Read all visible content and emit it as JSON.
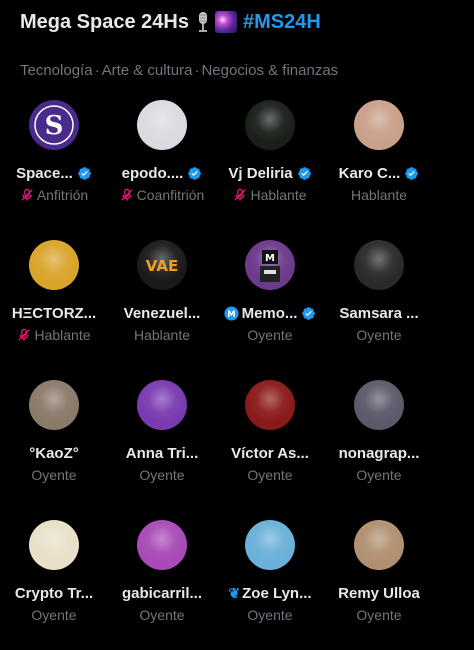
{
  "header": {
    "title": "Mega Space 24Hs",
    "emoji_1": "microphone-emoji",
    "emoji_2": "galaxy-emoji",
    "hashtag": "#MS24H"
  },
  "topics": [
    "Tecnología",
    "Arte & cultura",
    "Negocios &  finanzas"
  ],
  "topic_separator": "·",
  "colors": {
    "background": "#000000",
    "text": "#e7e9ea",
    "muted": "#71767b",
    "accent": "#1d9bf0",
    "mic_off": "#f91880"
  },
  "participants": [
    {
      "name": "Space...",
      "role": "Anfitrión",
      "verified": true,
      "muted": true,
      "avatar": "space-s-logo",
      "avatar_color": "#4a2a8a"
    },
    {
      "name": "epodo....",
      "role": "Coanfitrión",
      "verified": true,
      "muted": true,
      "avatar": "sketch-portrait",
      "avatar_color": "#d9dbe0"
    },
    {
      "name": "Vj Deliria",
      "role": "Hablante",
      "verified": true,
      "muted": true,
      "avatar": "glow-figure",
      "avatar_color": "#1a1f1a"
    },
    {
      "name": "Karo C...",
      "role": "Hablante",
      "verified": true,
      "muted": false,
      "avatar": "woman-photo",
      "avatar_color": "#c9a08a"
    },
    {
      "name": "HΞCTORZ...",
      "role": "Hablante",
      "verified": false,
      "muted": true,
      "avatar": "gold-art",
      "avatar_color": "#d9a42a"
    },
    {
      "name": "Venezuel...",
      "role": "Hablante",
      "verified": false,
      "muted": false,
      "avatar": "vae-logo",
      "avatar_color": "#1a1a1a"
    },
    {
      "name": "Memo...",
      "role": "Oyente",
      "verified": true,
      "muted": false,
      "avatar": "pixel-robot",
      "avatar_color": "#6b3a8a",
      "prefix_badge": "M"
    },
    {
      "name": "Samsara ...",
      "role": "Oyente",
      "verified": false,
      "muted": false,
      "avatar": "dark-figure",
      "avatar_color": "#2a2a2a"
    },
    {
      "name": "°KaoZ°",
      "role": "Oyente",
      "verified": false,
      "muted": false,
      "avatar": "nature-photo",
      "avatar_color": "#8a7a6a"
    },
    {
      "name": "Anna Tri...",
      "role": "Oyente",
      "verified": false,
      "muted": false,
      "avatar": "colorful-face",
      "avatar_color": "#7a3ab0"
    },
    {
      "name": "Víctor As...",
      "role": "Oyente",
      "verified": false,
      "muted": false,
      "avatar": "red-mask",
      "avatar_color": "#8a1a1a"
    },
    {
      "name": "nonagrap...",
      "role": "Oyente",
      "verified": false,
      "muted": false,
      "avatar": "masquerade-mask",
      "avatar_color": "#5a5a6a"
    },
    {
      "name": "Crypto Tr...",
      "role": "Oyente",
      "verified": false,
      "muted": false,
      "avatar": "cartoon-chars",
      "avatar_color": "#e8e0c8"
    },
    {
      "name": "gabicarril...",
      "role": "Oyente",
      "verified": false,
      "muted": false,
      "avatar": "cartoon-woman",
      "avatar_color": "#a84ab8"
    },
    {
      "name": "Zoe Lyn...",
      "role": "Oyente",
      "verified": false,
      "muted": false,
      "avatar": "robot-head",
      "avatar_color": "#6ab0d8",
      "prefix_emoji": "🦋"
    },
    {
      "name": "Remy Ulloa",
      "role": "Oyente",
      "verified": false,
      "muted": false,
      "avatar": "man-photo",
      "avatar_color": "#b09070"
    }
  ]
}
